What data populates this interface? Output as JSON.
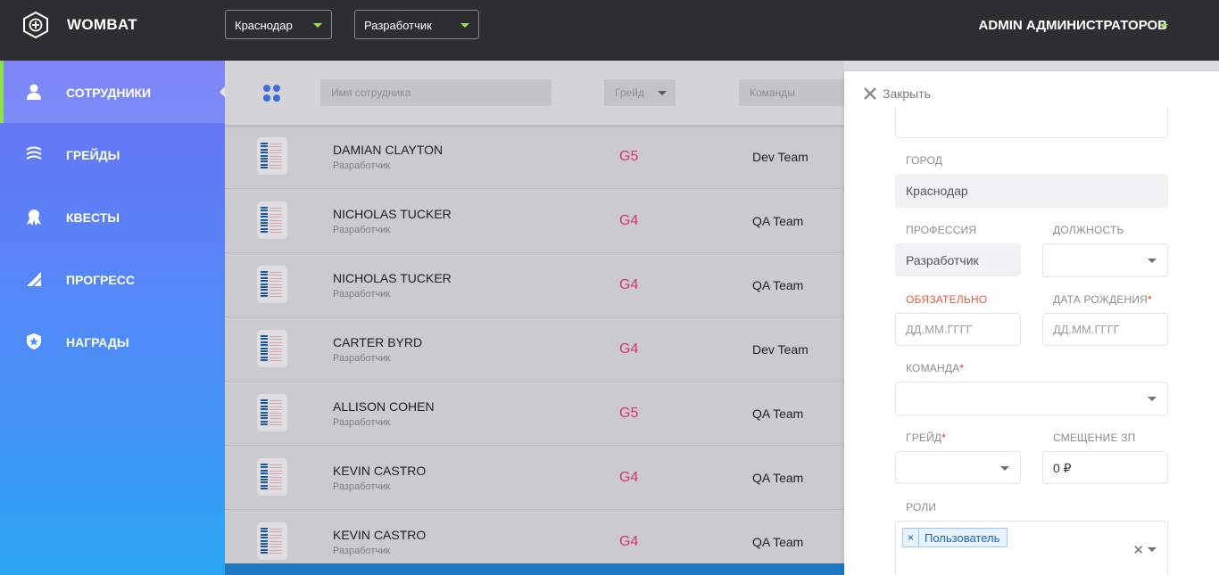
{
  "header": {
    "brand": "WOMBAT",
    "city_select": "Краснодар",
    "role_select": "Разработчик",
    "user_menu": "ADMIN АДМИНИСТРАТОРОВ"
  },
  "sidebar": {
    "items": [
      {
        "label": "СОТРУДНИКИ",
        "icon": "user-icon",
        "active": true
      },
      {
        "label": "ГРЕЙДЫ",
        "icon": "layers-icon",
        "active": false
      },
      {
        "label": "КВЕСТЫ",
        "icon": "medal-icon",
        "active": false
      },
      {
        "label": "ПРОГРЕСС",
        "icon": "signal-icon",
        "active": false
      },
      {
        "label": "НАГРАДЫ",
        "icon": "shield-star-icon",
        "active": false
      }
    ]
  },
  "filters": {
    "name_placeholder": "Имя сотрудника",
    "grade_placeholder": "Грейд",
    "teams_placeholder": "Команды"
  },
  "employees": [
    {
      "name": "DAMIAN CLAYTON",
      "role": "Разработчик",
      "grade": "G5",
      "team": "Dev Team"
    },
    {
      "name": "NICHOLAS TUCKER",
      "role": "Разработчик",
      "grade": "G4",
      "team": "QA Team"
    },
    {
      "name": "NICHOLAS TUCKER",
      "role": "Разработчик",
      "grade": "G4",
      "team": "QA Team"
    },
    {
      "name": "CARTER BYRD",
      "role": "Разработчик",
      "grade": "G4",
      "team": "Dev Team"
    },
    {
      "name": "ALLISON COHEN",
      "role": "Разработчик",
      "grade": "G5",
      "team": "QA Team"
    },
    {
      "name": "KEVIN CASTRO",
      "role": "Разработчик",
      "grade": "G4",
      "team": "QA Team"
    },
    {
      "name": "KEVIN CASTRO",
      "role": "Разработчик",
      "grade": "G4",
      "team": "QA Team"
    }
  ],
  "panel": {
    "close_label": "Закрыть",
    "city_label": "ГОРОД",
    "city_value": "Краснодар",
    "profession_label": "ПРОФЕССИЯ",
    "profession_value": "Разработчик",
    "position_label": "ДОЛЖНОСТЬ",
    "required_label": "ОБЯЗАТЕЛЬНО",
    "birthdate_label": "ДАТА РОЖДЕНИЯ",
    "date_placeholder": "ДД.ММ.ГГГГ",
    "team_label": "КОМАНДА",
    "grade_label": "ГРЕЙД",
    "salary_offset_label": "СМЕЩЕНИЕ ЗП",
    "salary_offset_value": "0 ₽",
    "roles_label": "РОЛИ",
    "role_tag": "Пользователь",
    "required_mark": "*"
  },
  "colors": {
    "topbar": "#2e2e30",
    "accent_green": "#8ee04c",
    "grade_pink": "#d6336c",
    "sidebar_top": "#6b72f6",
    "sidebar_bottom": "#2aa6f3"
  }
}
